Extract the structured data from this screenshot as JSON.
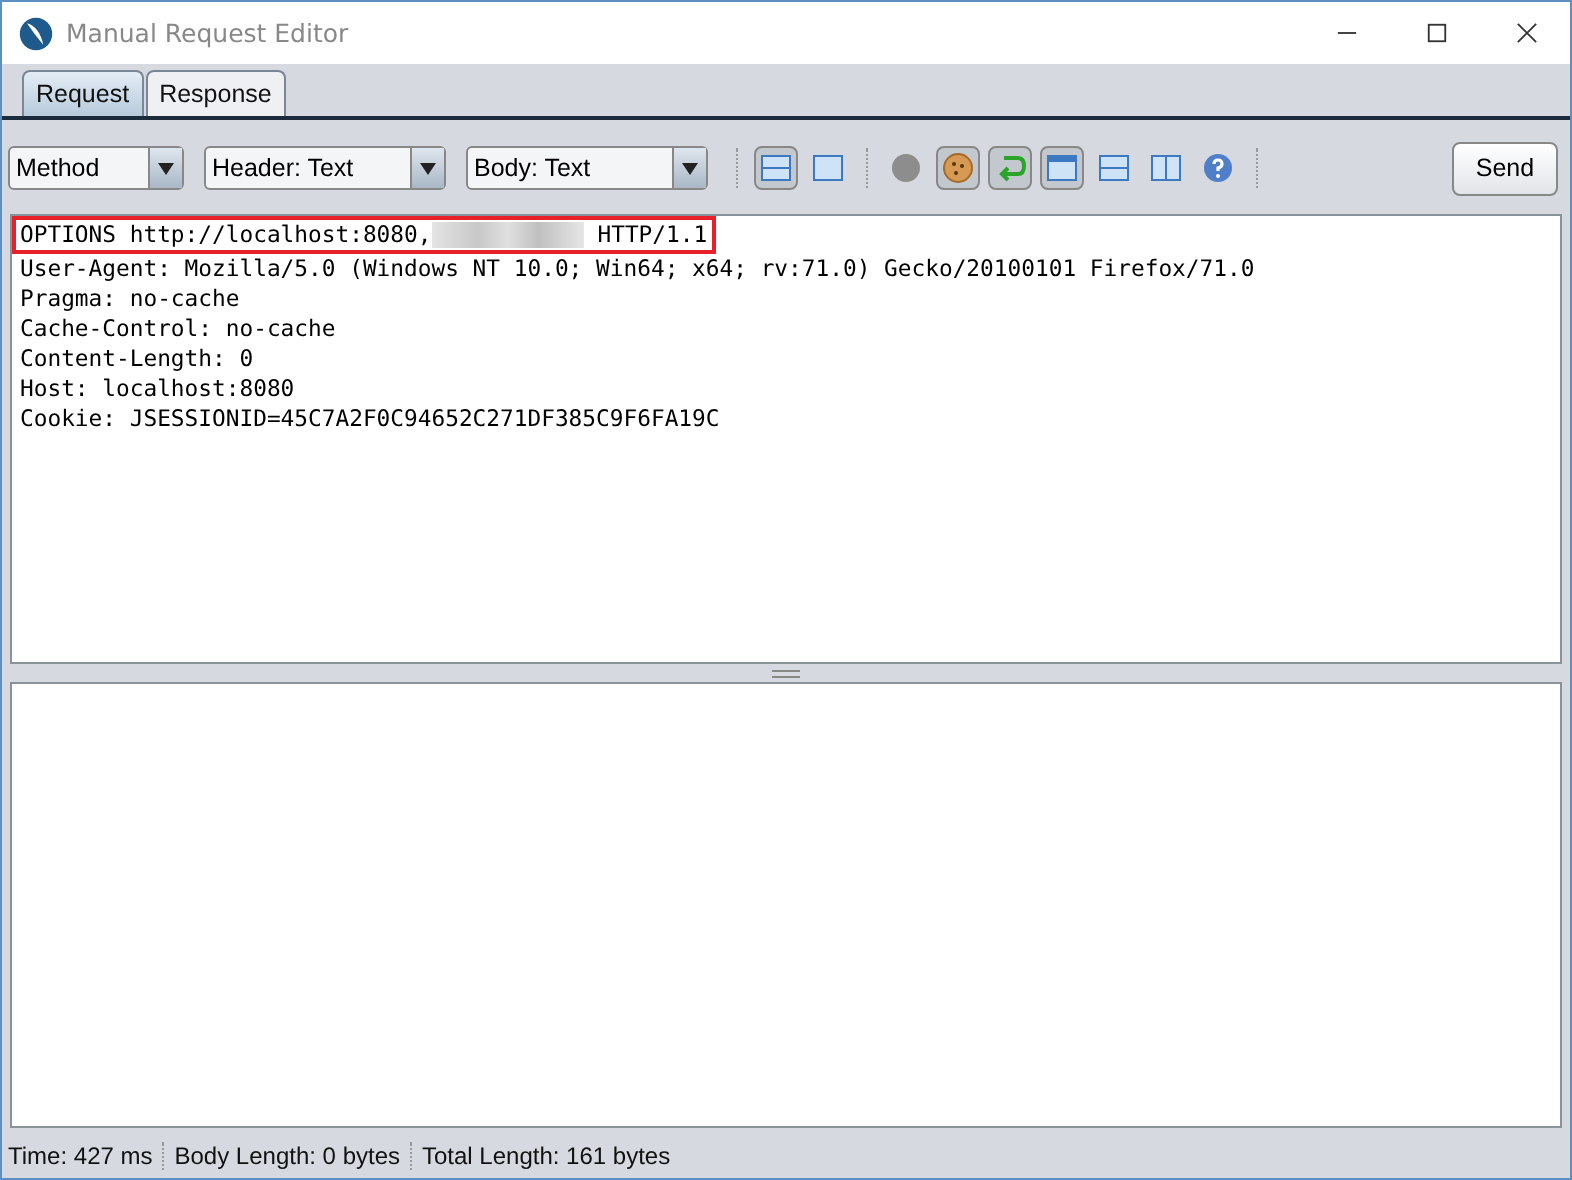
{
  "window": {
    "title": "Manual Request Editor"
  },
  "tabs": [
    {
      "label": "Request",
      "selected": true
    },
    {
      "label": "Response",
      "selected": false
    }
  ],
  "toolbar": {
    "dropdowns": [
      "Method",
      "Header: Text",
      "Body: Text"
    ],
    "tools": [
      {
        "kind": "split-rows",
        "pressed": true
      },
      {
        "kind": "single",
        "pressed": false
      },
      {
        "kind": "dot",
        "pressed": false
      },
      {
        "kind": "cookie",
        "pressed": true
      },
      {
        "kind": "return",
        "pressed": true
      },
      {
        "kind": "window",
        "pressed": true
      },
      {
        "kind": "split-rows",
        "pressed": false
      },
      {
        "kind": "split-columns",
        "pressed": false
      },
      {
        "kind": "help",
        "pressed": false
      }
    ],
    "send_label": "Send"
  },
  "request": {
    "first_line": {
      "start": "OPTIONS http://localhost:8080,",
      "end": "HTTP/1.1",
      "redacted": true,
      "highlighted": true
    },
    "header_lines": [
      "User-Agent: Mozilla/5.0 (Windows NT 10.0; Win64; x64; rv:71.0) Gecko/20100101 Firefox/71.0",
      "Pragma: no-cache",
      "Cache-Control: no-cache",
      "Content-Length: 0",
      "Host: localhost:8080",
      "Cookie: JSESSIONID=45C7A2F0C94652C271DF385C9F6FA19C"
    ]
  },
  "status_bar": [
    "Time: 427 ms",
    "Body Length: 0 bytes",
    "Total Length: 161 bytes"
  ]
}
